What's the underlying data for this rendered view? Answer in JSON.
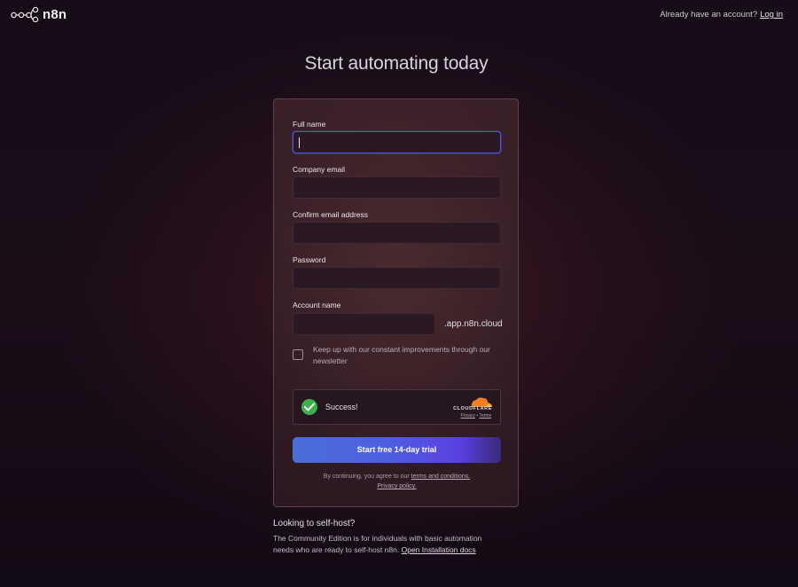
{
  "header": {
    "logo_text": "n8n",
    "login_prompt": "Already have an account?",
    "login_link": "Log in"
  },
  "page": {
    "title": "Start automating today"
  },
  "form": {
    "full_name": {
      "label": "Full name",
      "value": ""
    },
    "company_email": {
      "label": "Company email",
      "value": ""
    },
    "confirm_email": {
      "label": "Confirm email address",
      "value": ""
    },
    "password": {
      "label": "Password",
      "value": ""
    },
    "account_name": {
      "label": "Account name",
      "value": "",
      "suffix": ".app.n8n.cloud"
    },
    "newsletter": {
      "label": "Keep up with our constant improvements through our newsletter",
      "checked": false
    },
    "captcha": {
      "status": "Success!",
      "brand": "CLOUDFLARE",
      "privacy_link": "Privacy",
      "separator": "•",
      "terms_link": "Terms"
    },
    "submit_label": "Start free 14-day trial",
    "terms_prefix": "By continuing, you agree to our",
    "terms_link": "terms and conditions.",
    "privacy_link": "Privacy policy."
  },
  "selfhost": {
    "title": "Looking to self-host?",
    "text": "The Community Edition is for individuals with basic automation needs who are ready to self-host n8n.",
    "link": "Open Installation docs"
  },
  "colors": {
    "accent_focus": "#4b55e8",
    "button_start": "#4a6fd8",
    "button_end": "#5a40e2",
    "captcha_success": "#3cb14a",
    "cloudflare_orange": "#f38020"
  },
  "icons": {
    "logo": "n8n-nodes-logo-icon",
    "captcha_check": "check-circle-icon",
    "cloudflare": "cloudflare-cloud-icon"
  }
}
